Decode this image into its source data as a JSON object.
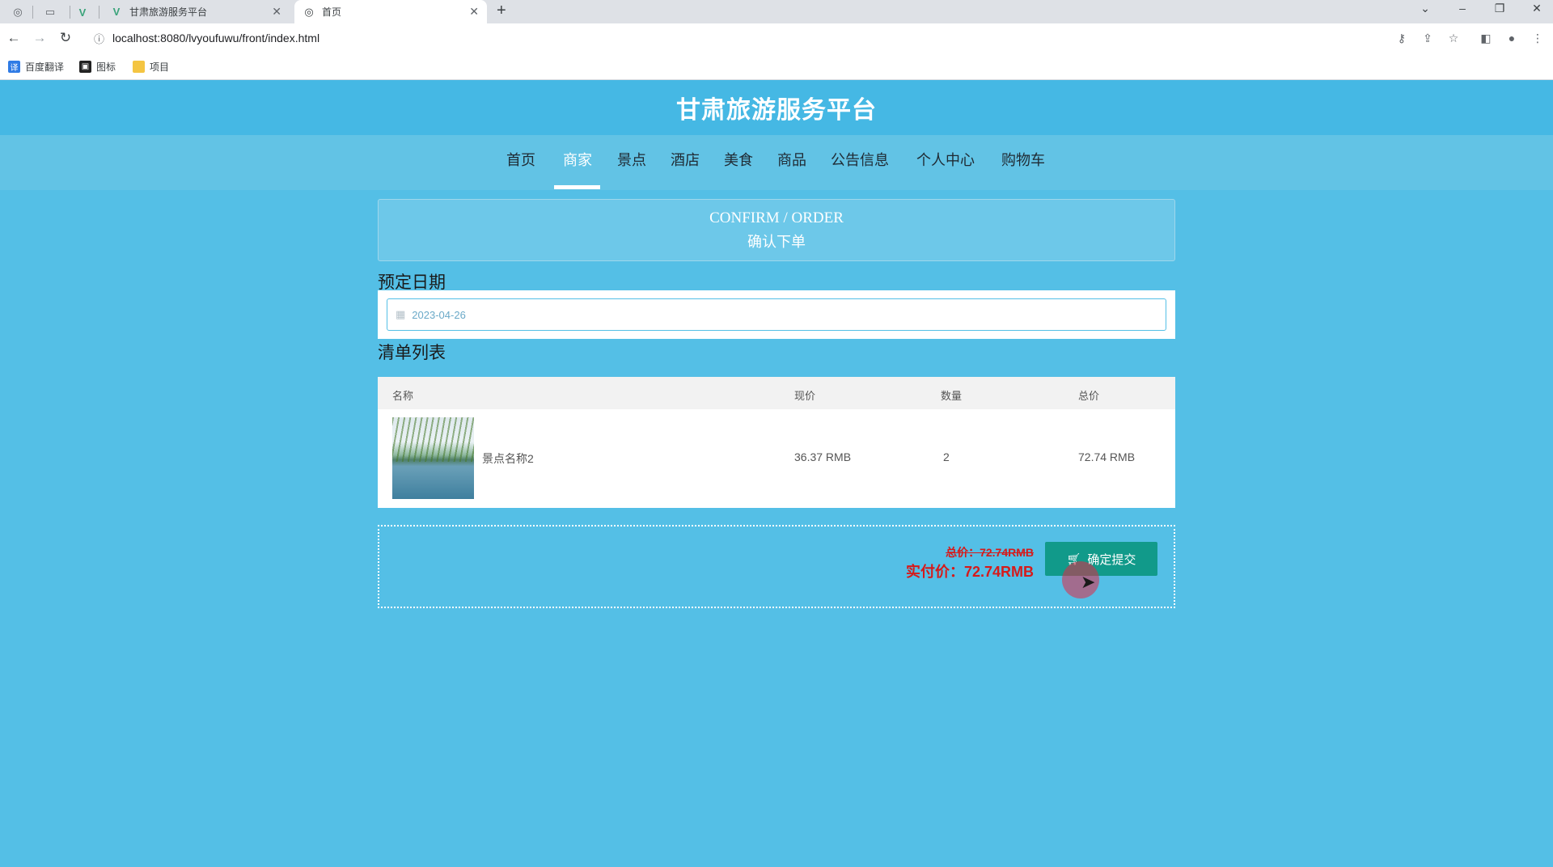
{
  "browser": {
    "tabs": [
      {
        "title": "甘肃旅游服务平台",
        "active": false
      },
      {
        "title": "首页",
        "active": true
      }
    ],
    "url": "localhost:8080/lvyoufuwu/front/index.html",
    "bookmarks": [
      "百度翻译",
      "图标",
      "项目"
    ]
  },
  "site": {
    "title": "甘肃旅游服务平台"
  },
  "nav": {
    "items": [
      "首页",
      "商家",
      "景点",
      "酒店",
      "美食",
      "商品",
      "公告信息",
      "个人中心",
      "购物车"
    ],
    "active": "商家"
  },
  "confirm": {
    "en": "CONFIRM / ORDER",
    "cn": "确认下单"
  },
  "booking": {
    "label": "预定日期",
    "date": "2023-04-26"
  },
  "list": {
    "label": "清单列表",
    "columns": [
      "名称",
      "现价",
      "数量",
      "总价"
    ],
    "rows": [
      {
        "name": "景点名称2",
        "price": "36.37 RMB",
        "quantity": "2",
        "total": "72.74 RMB"
      }
    ]
  },
  "summary": {
    "total": "总价：72.74RMB",
    "actual": "实付价：72.74RMB",
    "submit": "确定提交"
  },
  "colors": {
    "page_bg": "#54bfe6",
    "header_bg": "#45b8e4",
    "submit_bg": "#119a8a",
    "price_red": "#d61a1a"
  }
}
